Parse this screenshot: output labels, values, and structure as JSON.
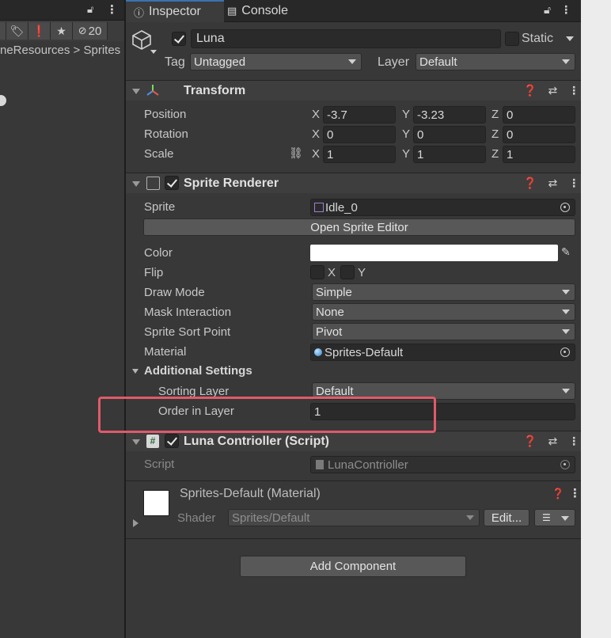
{
  "left": {
    "badge_count": "20",
    "breadcrumb": "neResources > Sprites"
  },
  "tabs": [
    {
      "label": "Inspector",
      "icon": "info-icon"
    },
    {
      "label": "Console",
      "icon": "console-icon"
    }
  ],
  "object": {
    "name": "Luna",
    "active": true,
    "static_label": "Static",
    "tag_label": "Tag",
    "tag_value": "Untagged",
    "layer_label": "Layer",
    "layer_value": "Default"
  },
  "transform": {
    "title": "Transform",
    "rows": [
      {
        "label": "Position",
        "x": "-3.7",
        "y": "-3.23",
        "z": "0"
      },
      {
        "label": "Rotation",
        "x": "0",
        "y": "0",
        "z": "0"
      },
      {
        "label": "Scale",
        "x": "1",
        "y": "1",
        "z": "1"
      }
    ],
    "axes": [
      "X",
      "Y",
      "Z"
    ]
  },
  "sprite_renderer": {
    "title": "Sprite Renderer",
    "sprite_label": "Sprite",
    "sprite_value": "Idle_0",
    "open_editor": "Open Sprite Editor",
    "color_label": "Color",
    "color_value": "#ffffff",
    "flip_label": "Flip",
    "flip_x": "X",
    "flip_y": "Y",
    "draw_mode_label": "Draw Mode",
    "draw_mode_value": "Simple",
    "mask_label": "Mask Interaction",
    "mask_value": "None",
    "sort_point_label": "Sprite Sort Point",
    "sort_point_value": "Pivot",
    "material_label": "Material",
    "material_value": "Sprites-Default",
    "additional_label": "Additional Settings",
    "sorting_layer_label": "Sorting Layer",
    "sorting_layer_value": "Default",
    "order_label": "Order in Layer",
    "order_value": "1"
  },
  "controller": {
    "title": "Luna Contrioller (Script)",
    "script_label": "Script",
    "script_value": "LunaContrioller"
  },
  "material": {
    "title": "Sprites-Default (Material)",
    "shader_label": "Shader",
    "shader_value": "Sprites/Default",
    "edit_label": "Edit..."
  },
  "add_component": "Add Component",
  "colors": {
    "highlight": "#e05a6a",
    "tab_accent": "#3a72b0"
  }
}
